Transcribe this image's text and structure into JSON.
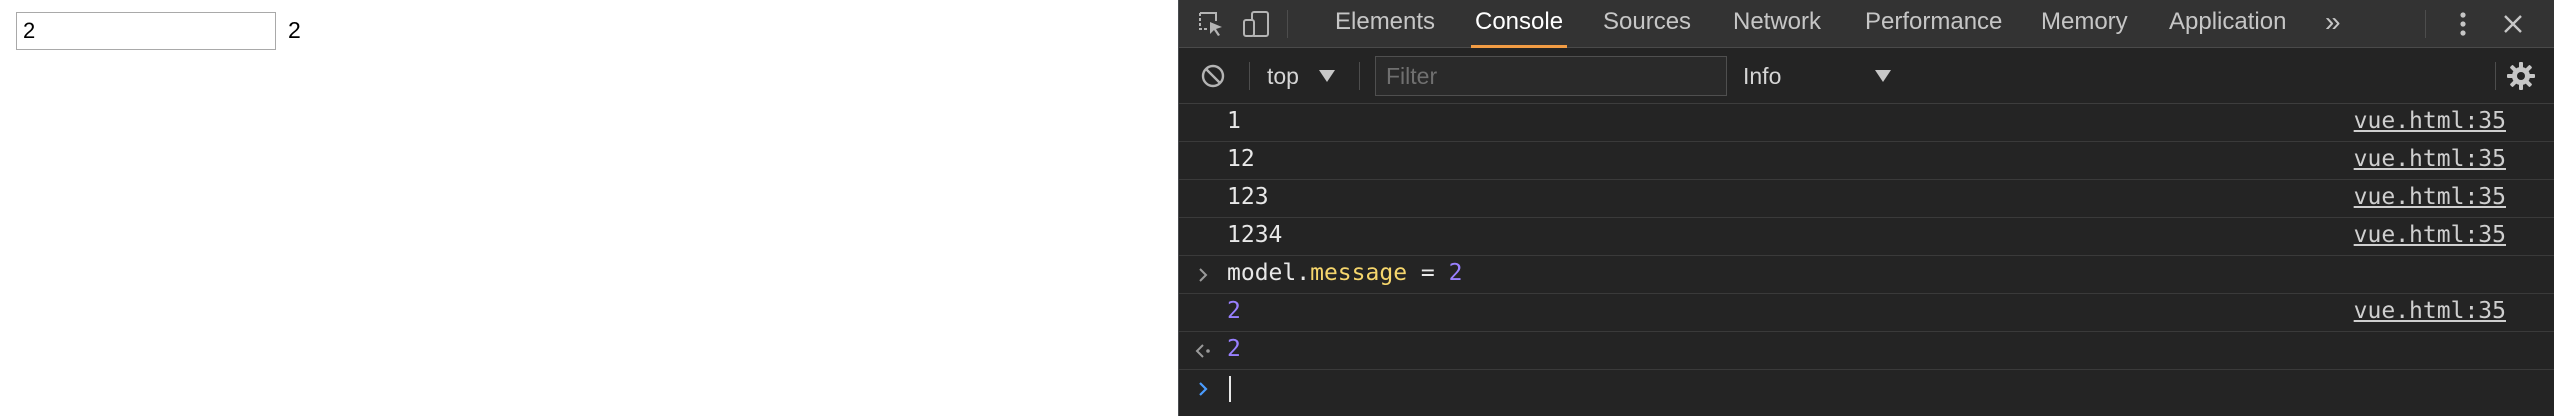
{
  "page": {
    "input_value": "2",
    "output_text": "2"
  },
  "devtools": {
    "toolbar": {
      "inspect_icon": "inspect-element-icon",
      "device_icon": "device-toolbar-icon",
      "more_tabs_icon": "chevron-double-right-icon",
      "kebab_icon": "vertical-dots-icon",
      "close_icon": "close-icon"
    },
    "tabs": [
      {
        "label": "Elements",
        "active": false
      },
      {
        "label": "Console",
        "active": true
      },
      {
        "label": "Sources",
        "active": false
      },
      {
        "label": "Network",
        "active": false
      },
      {
        "label": "Performance",
        "active": false
      },
      {
        "label": "Memory",
        "active": false
      },
      {
        "label": "Application",
        "active": false
      }
    ],
    "more_tabs_label": "»",
    "filterbar": {
      "clear_icon": "clear-console-icon",
      "context": "top",
      "filter_placeholder": "Filter",
      "level": "Info",
      "settings_icon": "gear-icon"
    },
    "accent_color": "#f29c44",
    "console": {
      "rows": [
        {
          "type": "log",
          "text": "1",
          "source": "vue.html:35"
        },
        {
          "type": "log",
          "text": "12",
          "source": "vue.html:35"
        },
        {
          "type": "log",
          "text": "123",
          "source": "vue.html:35"
        },
        {
          "type": "log",
          "text": "1234",
          "source": "vue.html:35"
        },
        {
          "type": "input",
          "code_object": "model",
          "code_dot": ".",
          "code_prop": "message",
          "code_op": " = ",
          "code_value": "2"
        },
        {
          "type": "log-number",
          "text": "2",
          "source": "vue.html:35"
        },
        {
          "type": "result",
          "text": "2"
        },
        {
          "type": "prompt",
          "text": ""
        }
      ]
    }
  }
}
